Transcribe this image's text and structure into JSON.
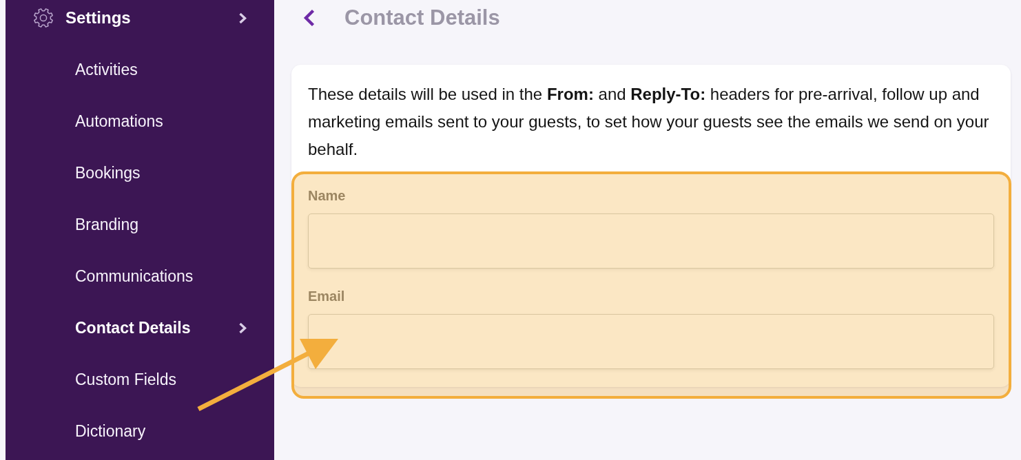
{
  "sidebar": {
    "header": {
      "label": "Settings"
    },
    "items": [
      {
        "label": "Activities",
        "selected": false
      },
      {
        "label": "Automations",
        "selected": false
      },
      {
        "label": "Bookings",
        "selected": false
      },
      {
        "label": "Branding",
        "selected": false
      },
      {
        "label": "Communications",
        "selected": false
      },
      {
        "label": "Contact Details",
        "selected": true
      },
      {
        "label": "Custom Fields",
        "selected": false
      },
      {
        "label": "Dictionary",
        "selected": false
      }
    ]
  },
  "page": {
    "title": "Contact Details"
  },
  "card": {
    "description": "These details will be used in the **From:** and **Reply-To:** headers for pre-arrival, follow up and marketing emails sent to your guests, to set how your guests see the emails we send on your behalf.",
    "fields": [
      {
        "label": "Name"
      },
      {
        "label": "Email"
      }
    ]
  }
}
